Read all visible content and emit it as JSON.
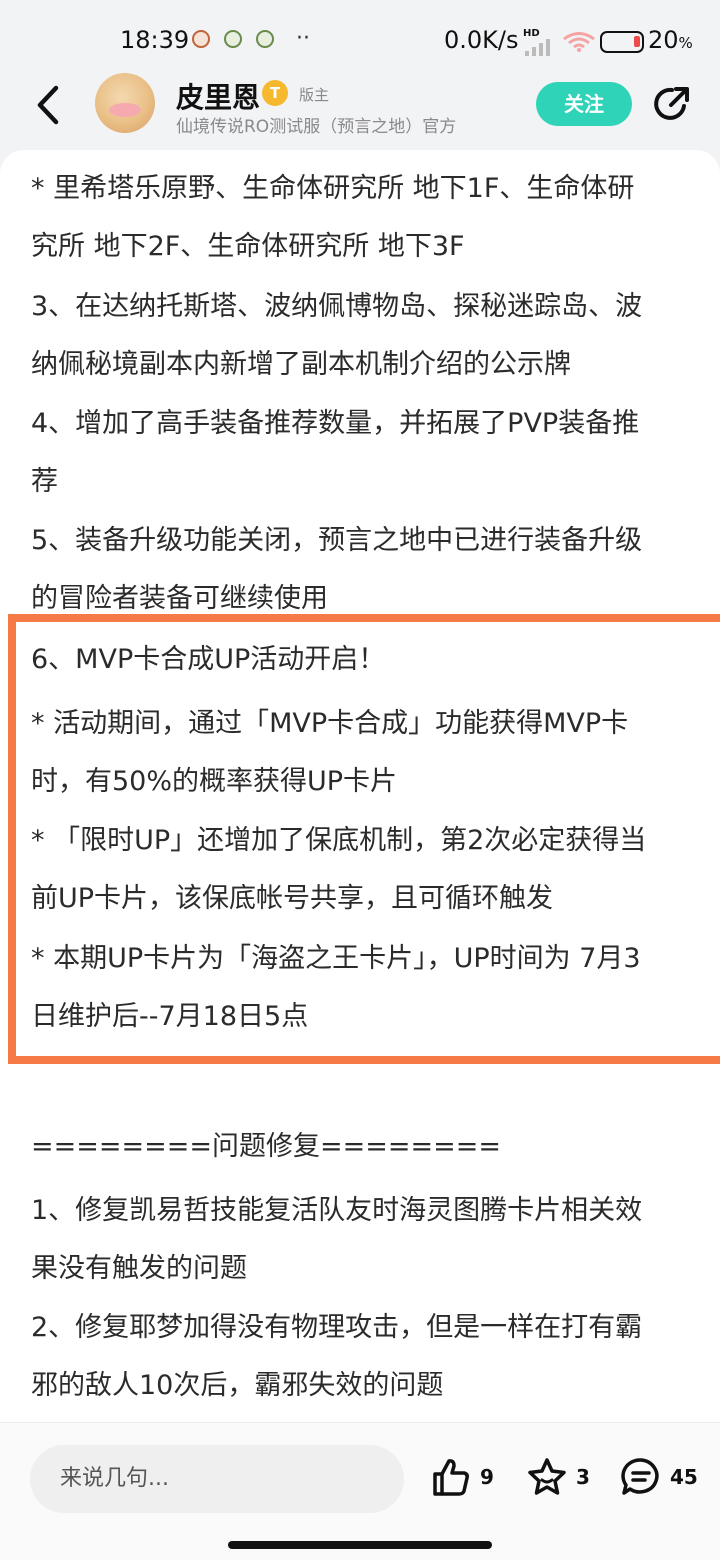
{
  "status_bar": {
    "time": "18:39",
    "more": "··",
    "network_speed": "0.0K/s",
    "hd": "HD",
    "battery_percent": "20",
    "battery_unit": "%"
  },
  "header": {
    "username": "皮里恩",
    "badge": "T",
    "role": "版主",
    "subtitle": "仙境传说RO测试服（预言之地）官方",
    "follow_label": "关注"
  },
  "content": {
    "lines": [
      "* 里希塔乐原野、生命体研究所 地下1F、生命体研",
      "究所 地下2F、生命体研究所 地下3F",
      "3、在达纳托斯塔、波纳佩博物岛、探秘迷踪岛、波",
      "纳佩秘境副本内新增了副本机制介绍的公示牌",
      "4、增加了高手装备推荐数量，并拓展了PVP装备推",
      "荐",
      "5、装备升级功能关闭，预言之地中已进行装备升级",
      "的冒险者装备可继续使用",
      "6、MVP卡合成UP活动开启！",
      "* 活动期间，通过「MVP卡合成」功能获得MVP卡",
      "时，有50%的概率获得UP卡片",
      "* 「限时UP」还增加了保底机制，第2次必定获得当",
      "前UP卡片，该保底帐号共享，且可循环触发",
      "* 本期UP卡片为「海盗之王卡片」，UP时间为 7月3",
      "日维护后--7月18日5点",
      "========问题修复========",
      "1、修复凯易哲技能复活队友时海灵图腾卡片相关效",
      "果没有触发的问题",
      "2、修复耶梦加得没有物理攻击，但是一样在打有霸",
      "邪的敌人10次后，霸邪失效的问题"
    ]
  },
  "bottom_bar": {
    "comment_placeholder": "来说几句...",
    "like_count": "9",
    "favorite_count": "3",
    "comment_count": "45"
  },
  "colors": {
    "accent": "#2ed3b8",
    "highlight_border": "#f57a45",
    "badge": "#f5b82e"
  }
}
